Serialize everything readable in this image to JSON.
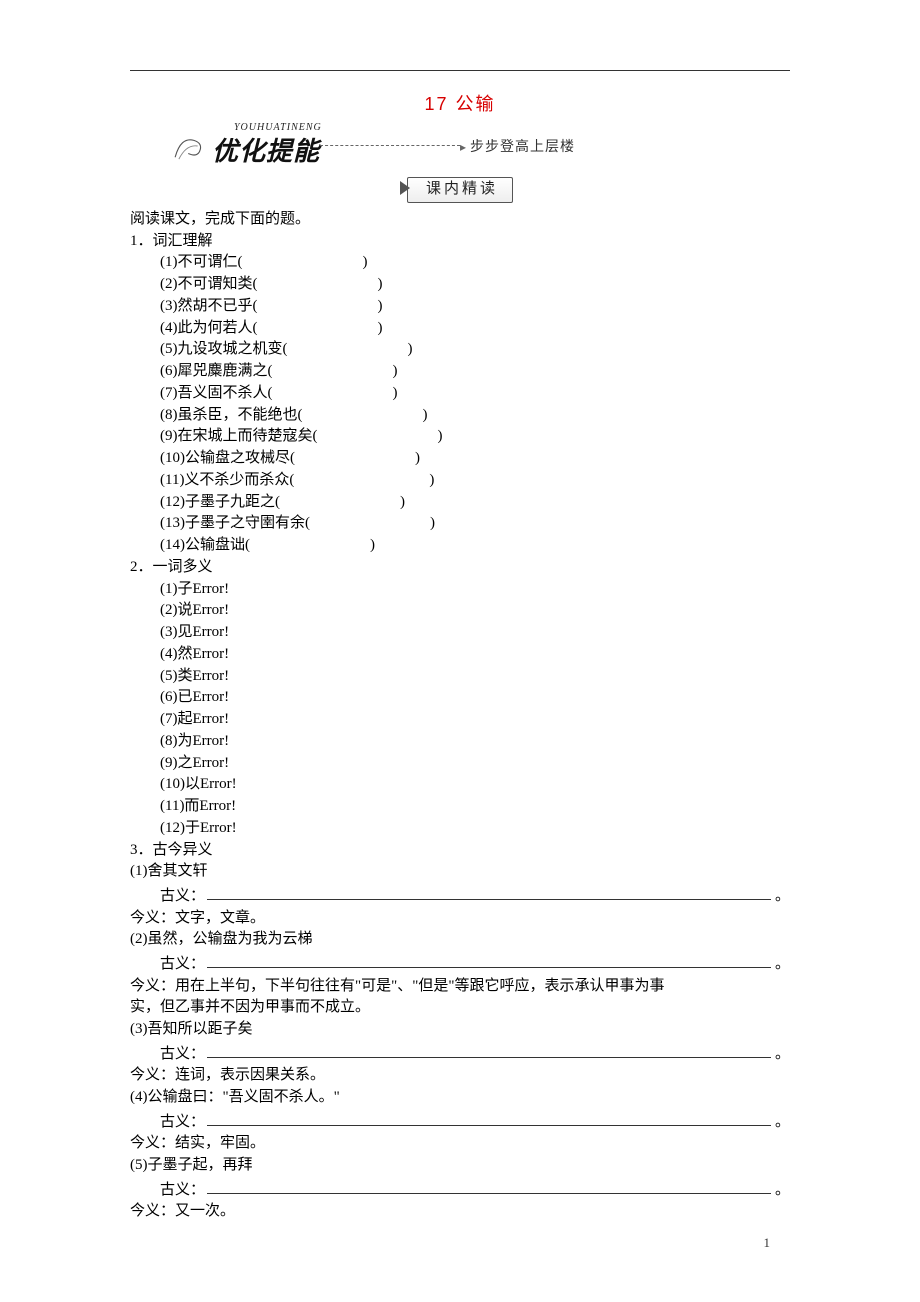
{
  "title": "17 公输",
  "banner": {
    "pinyin": "YOUHUATINENG",
    "main": "优化提能",
    "sub": "步步登高上层楼"
  },
  "section_label": "课内精读",
  "intro": "阅读课文，完成下面的题。",
  "q1_head": "1．词汇理解",
  "q1_items": [
    "(1)不可谓仁(　　　　　　　　)",
    "(2)不可谓知类(　　　　　　　　)",
    "(3)然胡不已乎(　　　　　　　　)",
    "(4)此为何若人(　　　　　　　　)",
    "(5)九设攻城之机变(　　　　　　　　)",
    "(6)犀兕麋鹿满之(　　　　　　　　)",
    "(7)吾义固不杀人(　　　　　　　　)",
    "(8)虽杀臣，不能绝也(　　　　　　　　)",
    "(9)在宋城上而待楚寇矣(　　　　　　　　)",
    "(10)公输盘之攻械尽(　　　　　　　　)",
    "(11)义不杀少而杀众(　　　　　　　　　)",
    "(12)子墨子九距之(　　　　　　　　)",
    "(13)子墨子之守圉有余(　　　　　　　　)",
    "(14)公输盘诎(　　　　　　　　)"
  ],
  "q2_head": "2．一词多义",
  "q2_items": [
    "(1)子Error!",
    "(2)说Error!",
    "(3)见Error!",
    "(4)然Error!",
    "(5)类Error!",
    "(6)已Error!",
    "(7)起Error!",
    "(8)为Error!",
    "(9)之Error!",
    "(10)以Error!",
    "(11)而Error!",
    "(12)于Error!"
  ],
  "q3_head": "3．古今异义",
  "q3_entries": [
    {
      "prompt": "  (1)舍其文轩",
      "modern": "今义：文字，文章。"
    },
    {
      "prompt": "(2)虽然，公输盘为我为云梯",
      "modern_lines": [
        "今义：用在上半句，下半句往往有\"可是\"、\"但是\"等跟它呼应，表示承认甲事为事",
        "实，但乙事并不因为甲事而不成立。"
      ]
    },
    {
      "prompt": "(3)吾知所以距子矣",
      "modern": "今义：连词，表示因果关系。"
    },
    {
      "prompt": "(4)公输盘曰：\"吾义固不杀人。\"",
      "modern": "今义：结实，牢固。"
    },
    {
      "prompt": "(5)子墨子起，再拜",
      "modern": "今义：又一次。"
    }
  ],
  "guyi_label": "古义：",
  "page_number": "1"
}
